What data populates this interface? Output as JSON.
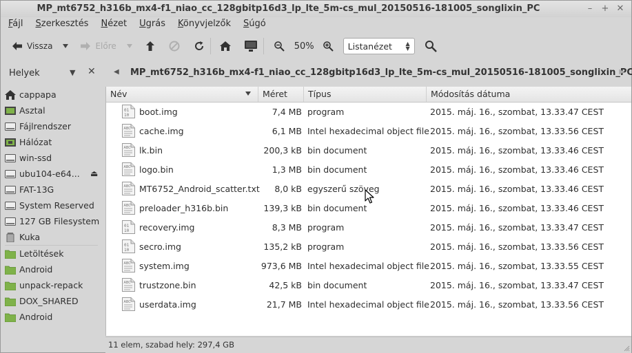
{
  "window": {
    "title": "MP_mt6752_h316b_mx4-f1_niao_cc_128gbitp16d3_lp_lte_5m-cs_mul_20150516-181005_songlixin_PC",
    "controls": {
      "minimize": "–",
      "maximize": "+",
      "close": "✕"
    }
  },
  "menubar": [
    {
      "key": "F",
      "rest": "ájl"
    },
    {
      "key": "S",
      "rest": "zerkesztés"
    },
    {
      "key": "N",
      "rest": "ézet"
    },
    {
      "key": "U",
      "rest": "grás"
    },
    {
      "key": "K",
      "rest": "önyvjelzők"
    },
    {
      "key": "S",
      "rest": "úgó"
    }
  ],
  "toolbar": {
    "back_label": "Vissza",
    "forward_label": "Előre",
    "zoom_level": "50%",
    "view_mode": "Listanézet"
  },
  "sidebar": {
    "title": "Helyek",
    "items_top": [
      {
        "label": "cappapa",
        "icon": "home-icon"
      },
      {
        "label": "Asztal",
        "icon": "desktop-icon"
      },
      {
        "label": "Fájlrendszer",
        "icon": "drive-icon"
      },
      {
        "label": "Hálózat",
        "icon": "network-icon"
      },
      {
        "label": "win-ssd",
        "icon": "drive-icon"
      },
      {
        "label": "ubu104-e64...",
        "icon": "drive-icon",
        "eject": true
      },
      {
        "label": "FAT-13G",
        "icon": "drive-icon"
      },
      {
        "label": "System Reserved",
        "icon": "drive-icon"
      },
      {
        "label": "127 GB Filesystem",
        "icon": "drive-icon"
      },
      {
        "label": "Kuka",
        "icon": "trash-icon"
      }
    ],
    "items_bookmarks": [
      {
        "label": "Letöltések",
        "icon": "folder-icon"
      },
      {
        "label": "Android",
        "icon": "folder-icon"
      },
      {
        "label": "unpack-repack",
        "icon": "folder-icon"
      },
      {
        "label": "DOX_SHARED",
        "icon": "folder-icon"
      },
      {
        "label": "Android",
        "icon": "folder-icon"
      }
    ]
  },
  "pathbar": {
    "current": "MP_mt6752_h316b_mx4-f1_niao_cc_128gbitp16d3_lp_lte_5m-cs_mul_20150516-181005_songlixin_PC"
  },
  "columns": {
    "name": "Név",
    "size": "Méret",
    "type": "Típus",
    "modified": "Módosítás dátuma"
  },
  "files": [
    {
      "name": "boot.img",
      "size": "7,4 MB",
      "type": "program",
      "modified": "2015. máj. 16., szombat, 13.33.47 CEST",
      "icon": "binary-file-icon"
    },
    {
      "name": "cache.img",
      "size": "6,1 MB",
      "type": "Intel hexadecimal object file",
      "modified": "2015. máj. 16., szombat, 13.33.56 CEST",
      "icon": "text-file-icon"
    },
    {
      "name": "lk.bin",
      "size": "200,3 kB",
      "type": "bin document",
      "modified": "2015. máj. 16., szombat, 13.33.46 CEST",
      "icon": "text-file-icon"
    },
    {
      "name": "logo.bin",
      "size": "1,3 MB",
      "type": "bin document",
      "modified": "2015. máj. 16., szombat, 13.33.46 CEST",
      "icon": "text-file-icon"
    },
    {
      "name": "MT6752_Android_scatter.txt",
      "size": "8,0 kB",
      "type": "egyszerű szöveg",
      "modified": "2015. máj. 16., szombat, 13.33.46 CEST",
      "icon": "text-file-icon"
    },
    {
      "name": "preloader_h316b.bin",
      "size": "139,3 kB",
      "type": "bin document",
      "modified": "2015. máj. 16., szombat, 13.33.46 CEST",
      "icon": "text-file-icon"
    },
    {
      "name": "recovery.img",
      "size": "8,3 MB",
      "type": "program",
      "modified": "2015. máj. 16., szombat, 13.33.47 CEST",
      "icon": "binary-file-icon"
    },
    {
      "name": "secro.img",
      "size": "135,2 kB",
      "type": "program",
      "modified": "2015. máj. 16., szombat, 13.33.56 CEST",
      "icon": "binary-file-icon"
    },
    {
      "name": "system.img",
      "size": "973,6 MB",
      "type": "Intel hexadecimal object file",
      "modified": "2015. máj. 16., szombat, 13.33.55 CEST",
      "icon": "text-file-icon"
    },
    {
      "name": "trustzone.bin",
      "size": "42,5 kB",
      "type": "bin document",
      "modified": "2015. máj. 16., szombat, 13.33.47 CEST",
      "icon": "text-file-icon"
    },
    {
      "name": "userdata.img",
      "size": "21,7 MB",
      "type": "Intel hexadecimal object file",
      "modified": "2015. máj. 16., szombat, 13.33.56 CEST",
      "icon": "text-file-icon"
    }
  ],
  "statusbar": {
    "text": "11 elem, szabad hely: 297,4 GB"
  },
  "colors": {
    "folder": "#7fb24a",
    "background": "#d6d6d6",
    "list_bg": "#ffffff"
  }
}
